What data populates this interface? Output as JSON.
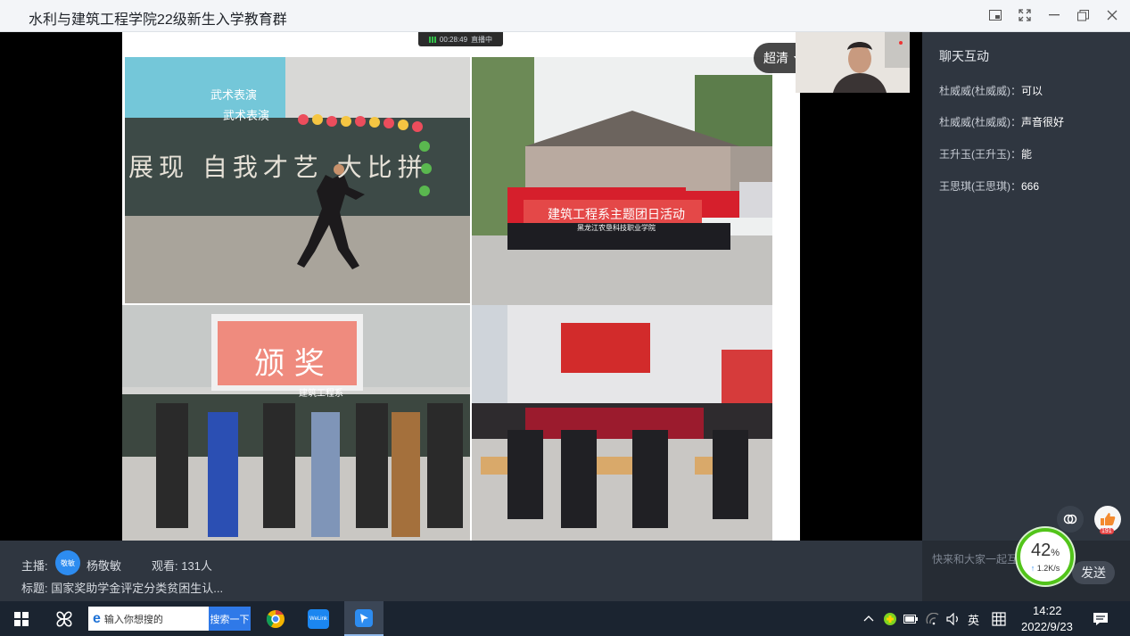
{
  "window": {
    "title": "水利与建筑工程学院22级新生入学教育群"
  },
  "stream": {
    "timer": "00:28:49",
    "live_status": "直播中",
    "quality_label": "超清"
  },
  "slide": {
    "photo1_text_top": "武术表演",
    "photo1_text_bottom": "武术表演",
    "photo1_banner": "展现 自我才艺 大比拼",
    "photo2_sign": "建筑工程系主题团日活动",
    "photo2_sign_sub": "黑龙江农垦科技职业学院",
    "photo3_title": "颁 奖",
    "photo3_subtitle": "建筑工程系"
  },
  "chat": {
    "header": "聊天互动",
    "messages": [
      {
        "sender": "杜威威(杜威威)：",
        "text": "可以"
      },
      {
        "sender": "杜威威(杜威威)：",
        "text": "声音很好"
      },
      {
        "sender": "王升玉(王升玉)：",
        "text": "能"
      },
      {
        "sender": "王思琪(王思琪)：",
        "text": "666"
      }
    ],
    "input_placeholder": "快来和大家一起互",
    "send_label": "发送",
    "like_count": "191"
  },
  "info": {
    "host_label": "主播:",
    "host_avatar_text": "敬敏",
    "host_name": "杨敬敏",
    "viewers": "观看: 131人",
    "topic": "标题: 国家奖助学金评定分类贫困生认..."
  },
  "speed": {
    "percent": "42",
    "percent_unit": "%",
    "rate": "1.2K/s"
  },
  "taskbar": {
    "search_placeholder": "输入你想搜的",
    "search_button": "搜索一下",
    "app_label": "WeLink",
    "ime": "英",
    "time": "14:22",
    "date": "2022/9/23"
  },
  "colors": {
    "panel": "#2f3640",
    "accent": "#2d8cf0",
    "speed_ring": "#52c41a",
    "taskbar": "#1b2430"
  }
}
